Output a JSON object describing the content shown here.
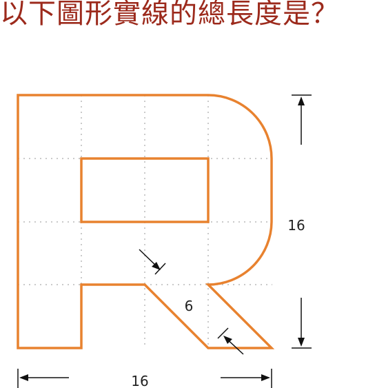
{
  "question": "以下圖形實線的總長度是？",
  "dimensions": {
    "height_label": "16",
    "width_label": "16",
    "slant_width_label": "6"
  },
  "colors": {
    "question_text": "#9c2a1c",
    "outline": "#e8822f",
    "grid": "#b8b8b8",
    "dimension_lines": "#111111"
  }
}
